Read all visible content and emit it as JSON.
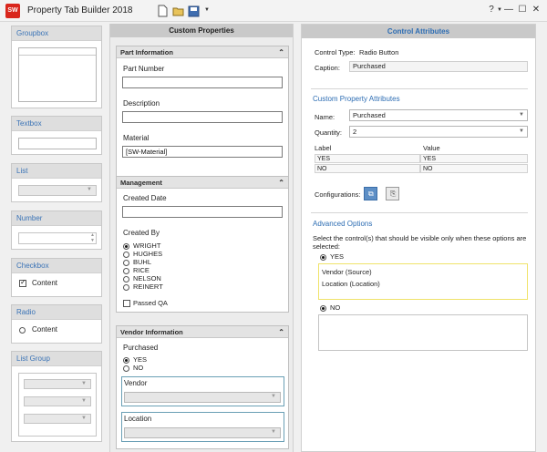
{
  "window": {
    "app_icon_label": "SW",
    "title": "Property Tab Builder   2018",
    "help_label": "?",
    "minimize_glyph": "—",
    "restore_glyph": "☐",
    "close_glyph": "✕"
  },
  "palette": {
    "groupbox": "Groupbox",
    "textbox": "Textbox",
    "list": "List",
    "number": "Number",
    "checkbox": "Checkbox",
    "checkbox_item": "Content",
    "radio": "Radio",
    "radio_item": "Content",
    "list_group": "List Group"
  },
  "custom_properties": {
    "heading": "Custom Properties",
    "part_information": {
      "title": "Part Information",
      "part_number_label": "Part Number",
      "part_number_value": "",
      "description_label": "Description",
      "description_value": "",
      "material_label": "Material",
      "material_value": "[SW-Material]"
    },
    "management": {
      "title": "Management",
      "created_date_label": "Created Date",
      "created_date_value": "",
      "created_by_label": "Created By",
      "created_by_options": [
        "WRIGHT",
        "HUGHES",
        "BUHL",
        "RICE",
        "NELSON",
        "REINERT"
      ],
      "passed_qa_label": "Passed QA"
    },
    "vendor_information": {
      "title": "Vendor Information",
      "purchased_label": "Purchased",
      "yes_label": "YES",
      "no_label": "NO",
      "vendor_label": "Vendor",
      "location_label": "Location"
    }
  },
  "control_attributes": {
    "heading": "Control Attributes",
    "control_type_label": "Control Type:",
    "control_type_value": "Radio Button",
    "caption_label": "Caption:",
    "caption_value": "Purchased",
    "custom_property_title": "Custom Property Attributes",
    "name_label": "Name:",
    "name_value": "Purchased",
    "quantity_label": "Quantity:",
    "quantity_value": "2",
    "table_headers": [
      "Label",
      "Value"
    ],
    "table_rows": [
      [
        "YES",
        "YES"
      ],
      [
        "NO",
        "NO"
      ]
    ],
    "configurations_label": "Configurations:",
    "advanced_title": "Advanced Options",
    "advanced_description": "Select the control(s) that should be visible only when these options are selected:",
    "yes_label": "YES",
    "yes_items": [
      "Vendor (Source)",
      "Location (Location)"
    ],
    "no_label": "NO"
  }
}
